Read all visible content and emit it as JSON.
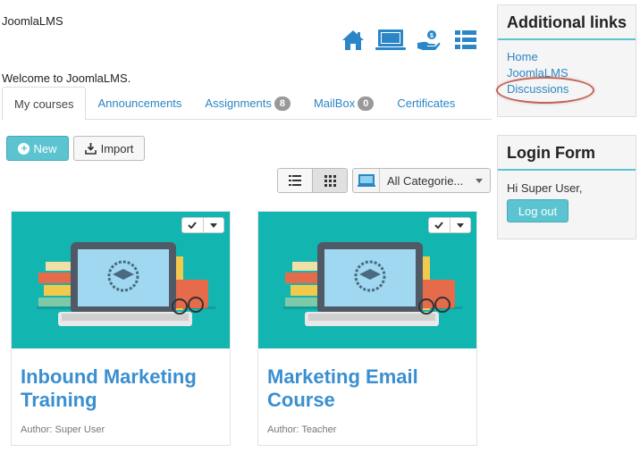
{
  "site": {
    "brand": "JoomlaLMS",
    "welcome": "Welcome to JoomlaLMS."
  },
  "toolbar_icons": [
    "home-icon",
    "monitor-icon",
    "hand-coin-icon",
    "list-icon"
  ],
  "colors": {
    "accent": "#5bc4d0",
    "link": "#2a86c6",
    "nav_icon": "#2a86c6",
    "card_thumb": "#12b5b0",
    "card_title": "#3a8fd0"
  },
  "tabs": [
    {
      "label": "My courses",
      "active": true
    },
    {
      "label": "Announcements"
    },
    {
      "label": "Assignments",
      "badge": "8"
    },
    {
      "label": "MailBox",
      "badge": "0"
    },
    {
      "label": "Certificates"
    }
  ],
  "actions": {
    "new_label": "New",
    "import_label": "Import"
  },
  "filter": {
    "category_selected": "All Categorie..."
  },
  "courses": [
    {
      "title": "Inbound Marketing Training",
      "author": "Author: Super User"
    },
    {
      "title": "Marketing Email Course",
      "author": "Author: Teacher"
    }
  ],
  "sidebar": {
    "links_title": "Additional links",
    "links": [
      "Home",
      "JoomlaLMS",
      "Discussions"
    ],
    "login_title": "Login Form",
    "greeting": "Hi Super User,",
    "logout_label": "Log out"
  }
}
